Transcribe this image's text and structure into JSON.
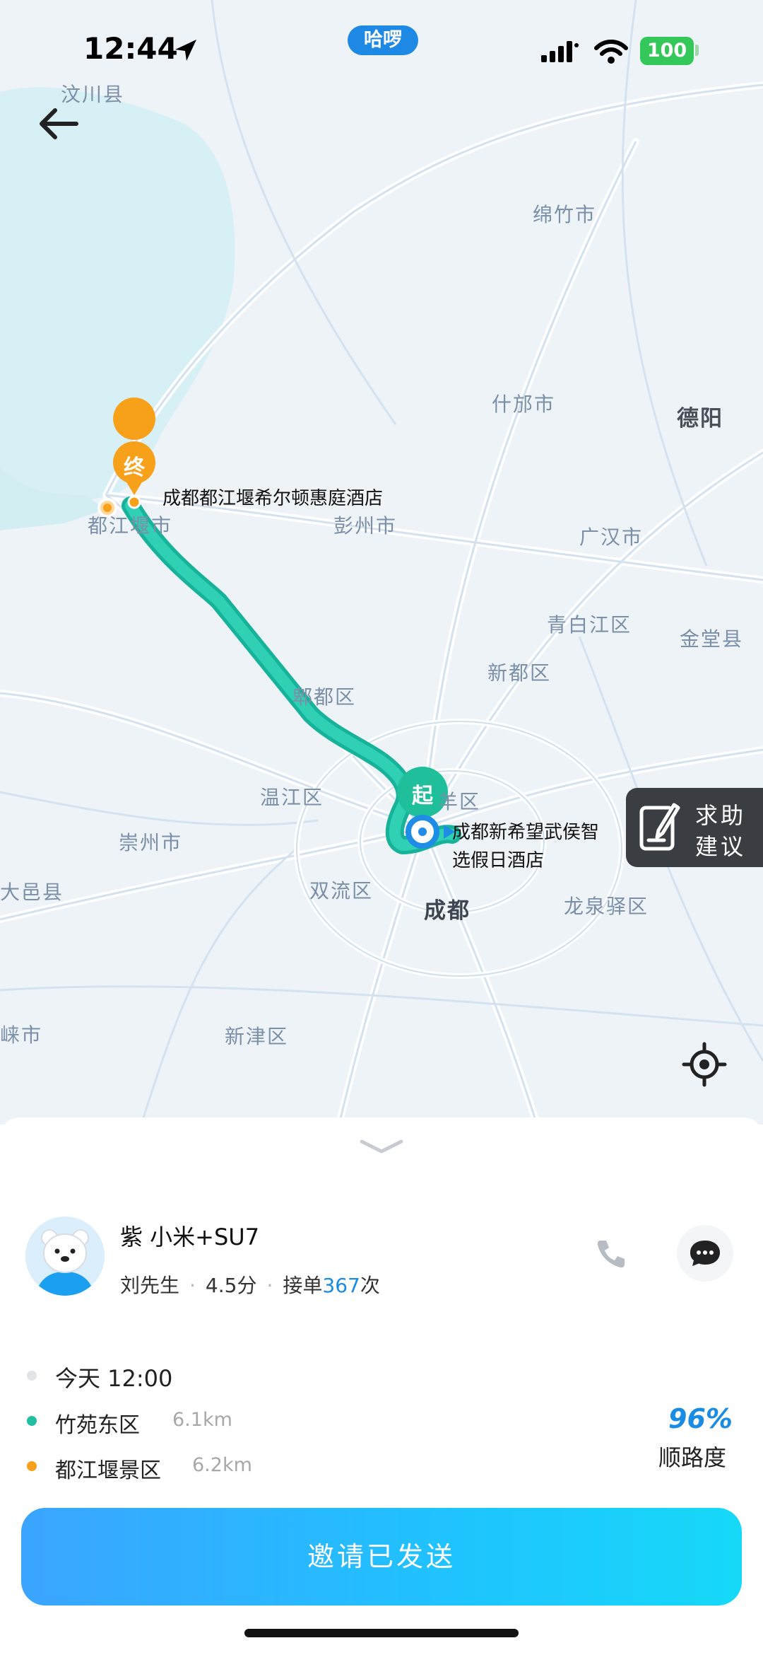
{
  "status_bar": {
    "time": "12:44",
    "app_pill": "哈啰",
    "battery": "100"
  },
  "map": {
    "places": {
      "wenchuan": "汶川县",
      "mianzhu": "绵竹市",
      "shifang": "什邡市",
      "deyang": "德阳",
      "dujiangyan": "都江堰市",
      "pengzhou": "彭州市",
      "guanghan": "广汉市",
      "qingbaijiang": "青白江区",
      "jintang": "金堂县",
      "xindu": "新都区",
      "pidu": "郫都区",
      "wenjiang": "温江区",
      "jinniu": "羊区",
      "chongzhou": "崇州市",
      "dayi": "大邑县",
      "shuangliu": "双流区",
      "chengdu": "成都",
      "longquanyi": "龙泉驿区",
      "qionglai": "崃市",
      "xinjin": "新津区"
    },
    "end_marker": "终",
    "start_marker": "起",
    "end_poi": "成都都江堰希尔顿惠庭酒店",
    "start_poi_line1": "成都新希望武侯智",
    "start_poi_line2": "选假日酒店",
    "help_button": {
      "line1": "求助",
      "line2": "建议"
    },
    "route_color": "#1fbfa0"
  },
  "driver": {
    "car": "紫 小米+SU7",
    "name": "刘先生",
    "rating": "4.5分",
    "orders_prefix": "接单",
    "orders_count": "367",
    "orders_suffix": "次"
  },
  "trip": {
    "depart_time": "今天 12:00",
    "from": "竹苑东区",
    "from_distance": "6.1km",
    "to": "都江堰景区",
    "to_distance": "6.2km",
    "match_percent": "96%",
    "match_label": "顺路度"
  },
  "cta": {
    "label": "邀请已发送"
  }
}
